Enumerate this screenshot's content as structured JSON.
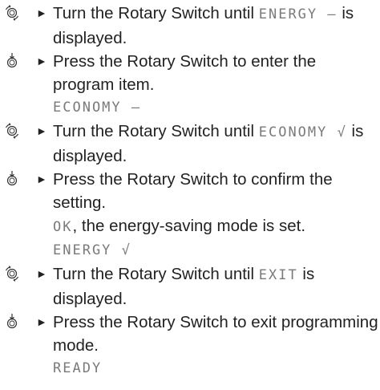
{
  "steps": [
    {
      "icon": "rotary-turn-icon",
      "bullet": "►",
      "text_before": "Turn the Rotary Switch until ",
      "lcd": "ENERGY —",
      "text_after": " is displayed."
    },
    {
      "icon": "rotary-press-icon",
      "bullet": "►",
      "text": "Press the Rotary Switch to enter the program item.",
      "display": "ECONOMY —"
    },
    {
      "icon": "rotary-turn-icon",
      "bullet": "►",
      "text_before": "Turn the Rotary Switch until ",
      "lcd": "ECONOMY √",
      "text_after": " is displayed."
    },
    {
      "icon": "rotary-press-icon",
      "bullet": "►",
      "text": "Press the Rotary Switch to confirm the setting.",
      "note_lcd": "OK",
      "note_text": ", the energy-saving mode is set.",
      "display": "ENERGY √"
    },
    {
      "icon": "rotary-turn-icon",
      "bullet": "►",
      "text_before": "Turn the Rotary Switch until ",
      "lcd": "EXIT",
      "text_after": " is displayed."
    },
    {
      "icon": "rotary-press-icon",
      "bullet": "►",
      "text": "Press the Rotary Switch to exit programming mode.",
      "display": "READY"
    }
  ]
}
